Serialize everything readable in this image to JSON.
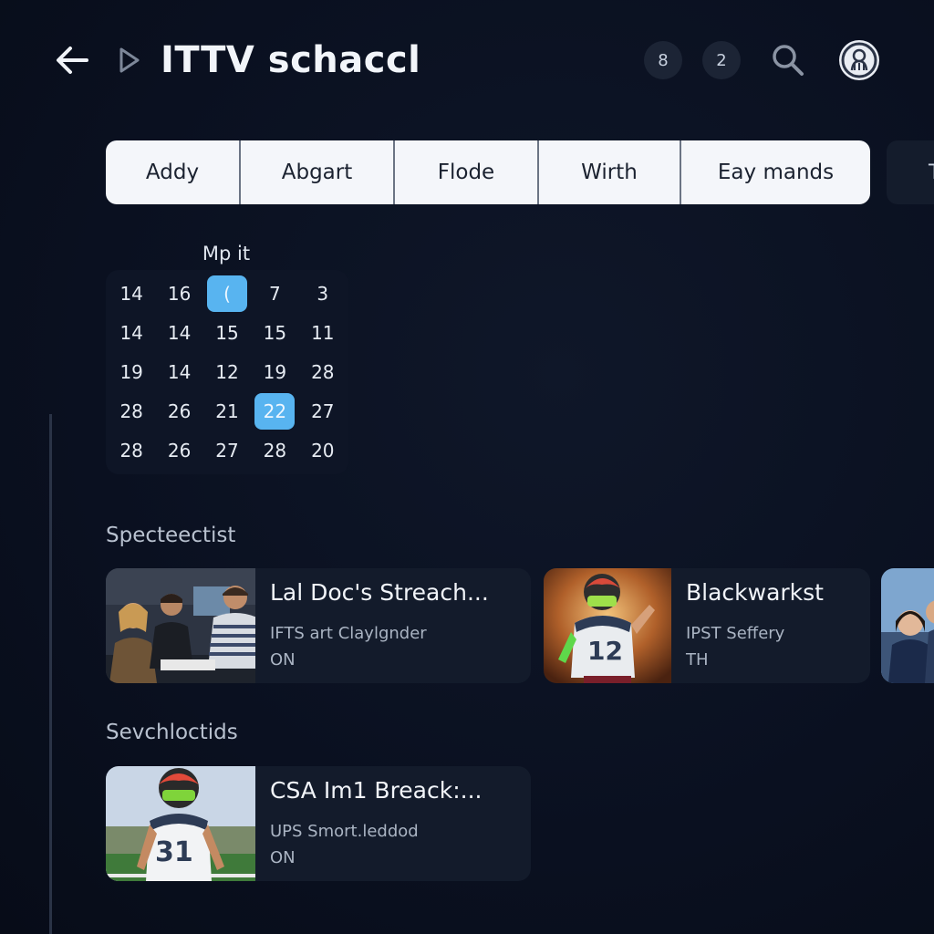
{
  "header": {
    "title": "ITTV schaccl",
    "badge_a": "8",
    "badge_b": "2"
  },
  "filters": {
    "tabs": [
      {
        "label": "Addy"
      },
      {
        "label": "Abgart"
      },
      {
        "label": "Flode"
      },
      {
        "label": "Wirth"
      },
      {
        "label": "Eay mands"
      }
    ],
    "partial_label": "T"
  },
  "calendar": {
    "title": "Mp it",
    "selected_values": [
      "(",
      "22"
    ],
    "rows": [
      [
        "14",
        "16",
        "(",
        "7",
        "3"
      ],
      [
        "14",
        "14",
        "15",
        "15",
        "11"
      ],
      [
        "19",
        "14",
        "12",
        "19",
        "28"
      ],
      [
        "28",
        "26",
        "21",
        "22",
        "27"
      ],
      [
        "28",
        "26",
        "27",
        "28",
        "20"
      ]
    ]
  },
  "sections": [
    {
      "title": "Specteectist",
      "cards": [
        {
          "title": "Lal Doc's Streach...",
          "subtitle": "IFTS art Claylgnder",
          "status": "ON",
          "thumb": "studio-panel"
        },
        {
          "title": "Blackwarkst",
          "subtitle": "IPST Seffery",
          "status": "TH",
          "thumb": "football-player"
        },
        {
          "title": "",
          "subtitle": "",
          "status": "",
          "thumb": "people-portrait"
        }
      ]
    },
    {
      "title": "Sevchloctids",
      "cards": [
        {
          "title": "CSA Im1 Breack:...",
          "subtitle": "UPS Smort.leddod",
          "status": "ON",
          "thumb": "football-player-field"
        }
      ]
    }
  ],
  "icons": {
    "back": "arrow-left-icon",
    "play": "play-icon",
    "search": "search-icon",
    "profile": "profile-icon"
  },
  "colors": {
    "background": "#0a1020",
    "accent": "#58b4f0",
    "card": "#131b2b",
    "filter_bar": "#f4f6fa"
  }
}
